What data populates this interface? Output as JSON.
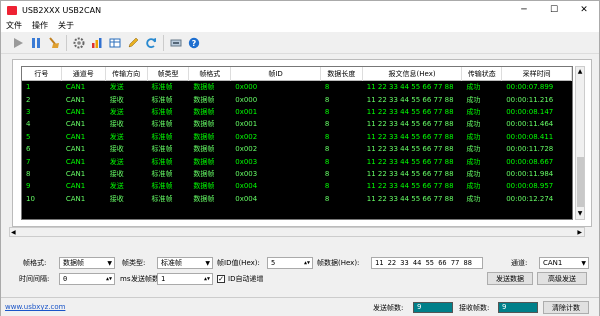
{
  "window": {
    "title": "USB2XXX USB2CAN",
    "minimize": "─",
    "maximize": "☐",
    "close": "✕"
  },
  "menu": [
    "文件",
    "操作",
    "关于"
  ],
  "toolbar": [
    "play-icon",
    "pause-icon",
    "clear-icon",
    "settings-icon",
    "chart-icon",
    "table-icon",
    "edit-icon",
    "refresh-icon",
    "device-icon",
    "help-icon"
  ],
  "table": {
    "headers": [
      "行号",
      "通道号",
      "传输方向",
      "帧类型",
      "帧格式",
      "帧ID",
      "数据长度",
      "报文信息(Hex)",
      "传输状态",
      "采样时间"
    ],
    "rows": [
      [
        "1",
        "CAN1",
        "发送",
        "标准帧",
        "数据帧",
        "0x000",
        "8",
        "11 22 33 44 55 66 77 88",
        "成功",
        "00:00:07.899"
      ],
      [
        "2",
        "CAN1",
        "接收",
        "标准帧",
        "数据帧",
        "0x000",
        "8",
        "11 22 33 44 55 66 77 88",
        "成功",
        "00:00:11.216"
      ],
      [
        "3",
        "CAN1",
        "发送",
        "标准帧",
        "数据帧",
        "0x001",
        "8",
        "11 22 33 44 55 66 77 88",
        "成功",
        "00:00:08.147"
      ],
      [
        "4",
        "CAN1",
        "接收",
        "标准帧",
        "数据帧",
        "0x001",
        "8",
        "11 22 33 44 55 66 77 88",
        "成功",
        "00:00:11.464"
      ],
      [
        "5",
        "CAN1",
        "发送",
        "标准帧",
        "数据帧",
        "0x002",
        "8",
        "11 22 33 44 55 66 77 88",
        "成功",
        "00:00:08.411"
      ],
      [
        "6",
        "CAN1",
        "接收",
        "标准帧",
        "数据帧",
        "0x002",
        "8",
        "11 22 33 44 55 66 77 88",
        "成功",
        "00:00:11.728"
      ],
      [
        "7",
        "CAN1",
        "发送",
        "标准帧",
        "数据帧",
        "0x003",
        "8",
        "11 22 33 44 55 66 77 88",
        "成功",
        "00:00:08.667"
      ],
      [
        "8",
        "CAN1",
        "接收",
        "标准帧",
        "数据帧",
        "0x003",
        "8",
        "11 22 33 44 55 66 77 88",
        "成功",
        "00:00:11.984"
      ],
      [
        "9",
        "CAN1",
        "发送",
        "标准帧",
        "数据帧",
        "0x004",
        "8",
        "11 22 33 44 55 66 77 88",
        "成功",
        "00:00:08.957"
      ],
      [
        "10",
        "CAN1",
        "接收",
        "标准帧",
        "数据帧",
        "0x004",
        "8",
        "11 22 33 44 55 66 77 88",
        "成功",
        "00:00:12.274"
      ]
    ]
  },
  "controls": {
    "frame_format_label": "帧格式:",
    "frame_format_value": "数据帧",
    "frame_type_label": "帧类型:",
    "frame_type_value": "标准帧",
    "frame_id_label": "帧ID值(Hex):",
    "frame_id_value": "5",
    "frame_data_label": "帧数据(Hex):",
    "frame_data_value": "11 22 33 44 55 66 77 88",
    "channel_label": "通道:",
    "channel_value": "CAN1",
    "interval_label": "时间间隔:",
    "interval_value": "0",
    "interval_unit": "ms",
    "send_frames_label": "发送帧数:",
    "send_frames_value": "1",
    "id_increment_label": "ID自动递增",
    "id_increment_checked": "✓",
    "send_button": "发送数据",
    "advanced_button": "高级发送"
  },
  "status": {
    "link": "www.usbxyz.com",
    "sent_label": "发送帧数:",
    "sent_value": "9",
    "recv_label": "接收帧数:",
    "recv_value": "9",
    "clear_button": "清除计数"
  },
  "colors": {
    "send_row": "#00ff00",
    "recv_row": "#66ff66",
    "grid_bg": "#000000",
    "counter_bg": "#00808a"
  }
}
